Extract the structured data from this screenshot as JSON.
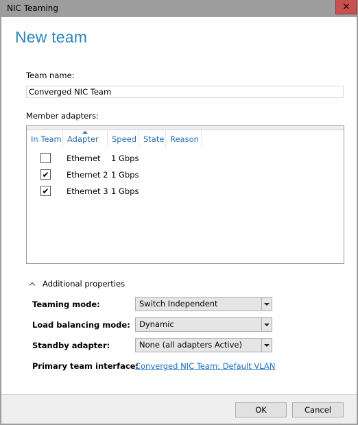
{
  "window": {
    "title": "NIC Teaming",
    "close_icon": "close-x-icon",
    "colors": {
      "close_bg": "#c75050",
      "accent": "#2a87b8",
      "link": "#1a6fc1"
    }
  },
  "dialog": {
    "heading": "New team",
    "team_name_label": "Team name:",
    "team_name_value": "Converged NIC Team",
    "member_adapters_label": "Member adapters:"
  },
  "adapters": {
    "columns": [
      "In Team",
      "Adapter",
      "Speed",
      "State",
      "Reason"
    ],
    "sorted_column": "Adapter",
    "rows": [
      {
        "in_team": false,
        "in_team_glyph": "",
        "adapter": "Ethernet",
        "speed": "1 Gbps",
        "state": "",
        "reason": ""
      },
      {
        "in_team": true,
        "in_team_glyph": "✔",
        "adapter": "Ethernet 2",
        "speed": "1 Gbps",
        "state": "",
        "reason": ""
      },
      {
        "in_team": true,
        "in_team_glyph": "✔",
        "adapter": "Ethernet 3",
        "speed": "1 Gbps",
        "state": "",
        "reason": ""
      }
    ]
  },
  "additional": {
    "toggle_label": "Additional properties",
    "expanded": true,
    "teaming_mode_label": "Teaming mode:",
    "teaming_mode_value": "Switch Independent",
    "load_balancing_label": "Load balancing mode:",
    "load_balancing_value": "Dynamic",
    "standby_label": "Standby adapter:",
    "standby_value": "None (all adapters Active)",
    "primary_interface_label": "Primary team interface:",
    "primary_interface_link": "Converged NIC Team: Default VLAN"
  },
  "footer": {
    "ok_label": "OK",
    "cancel_label": "Cancel"
  }
}
